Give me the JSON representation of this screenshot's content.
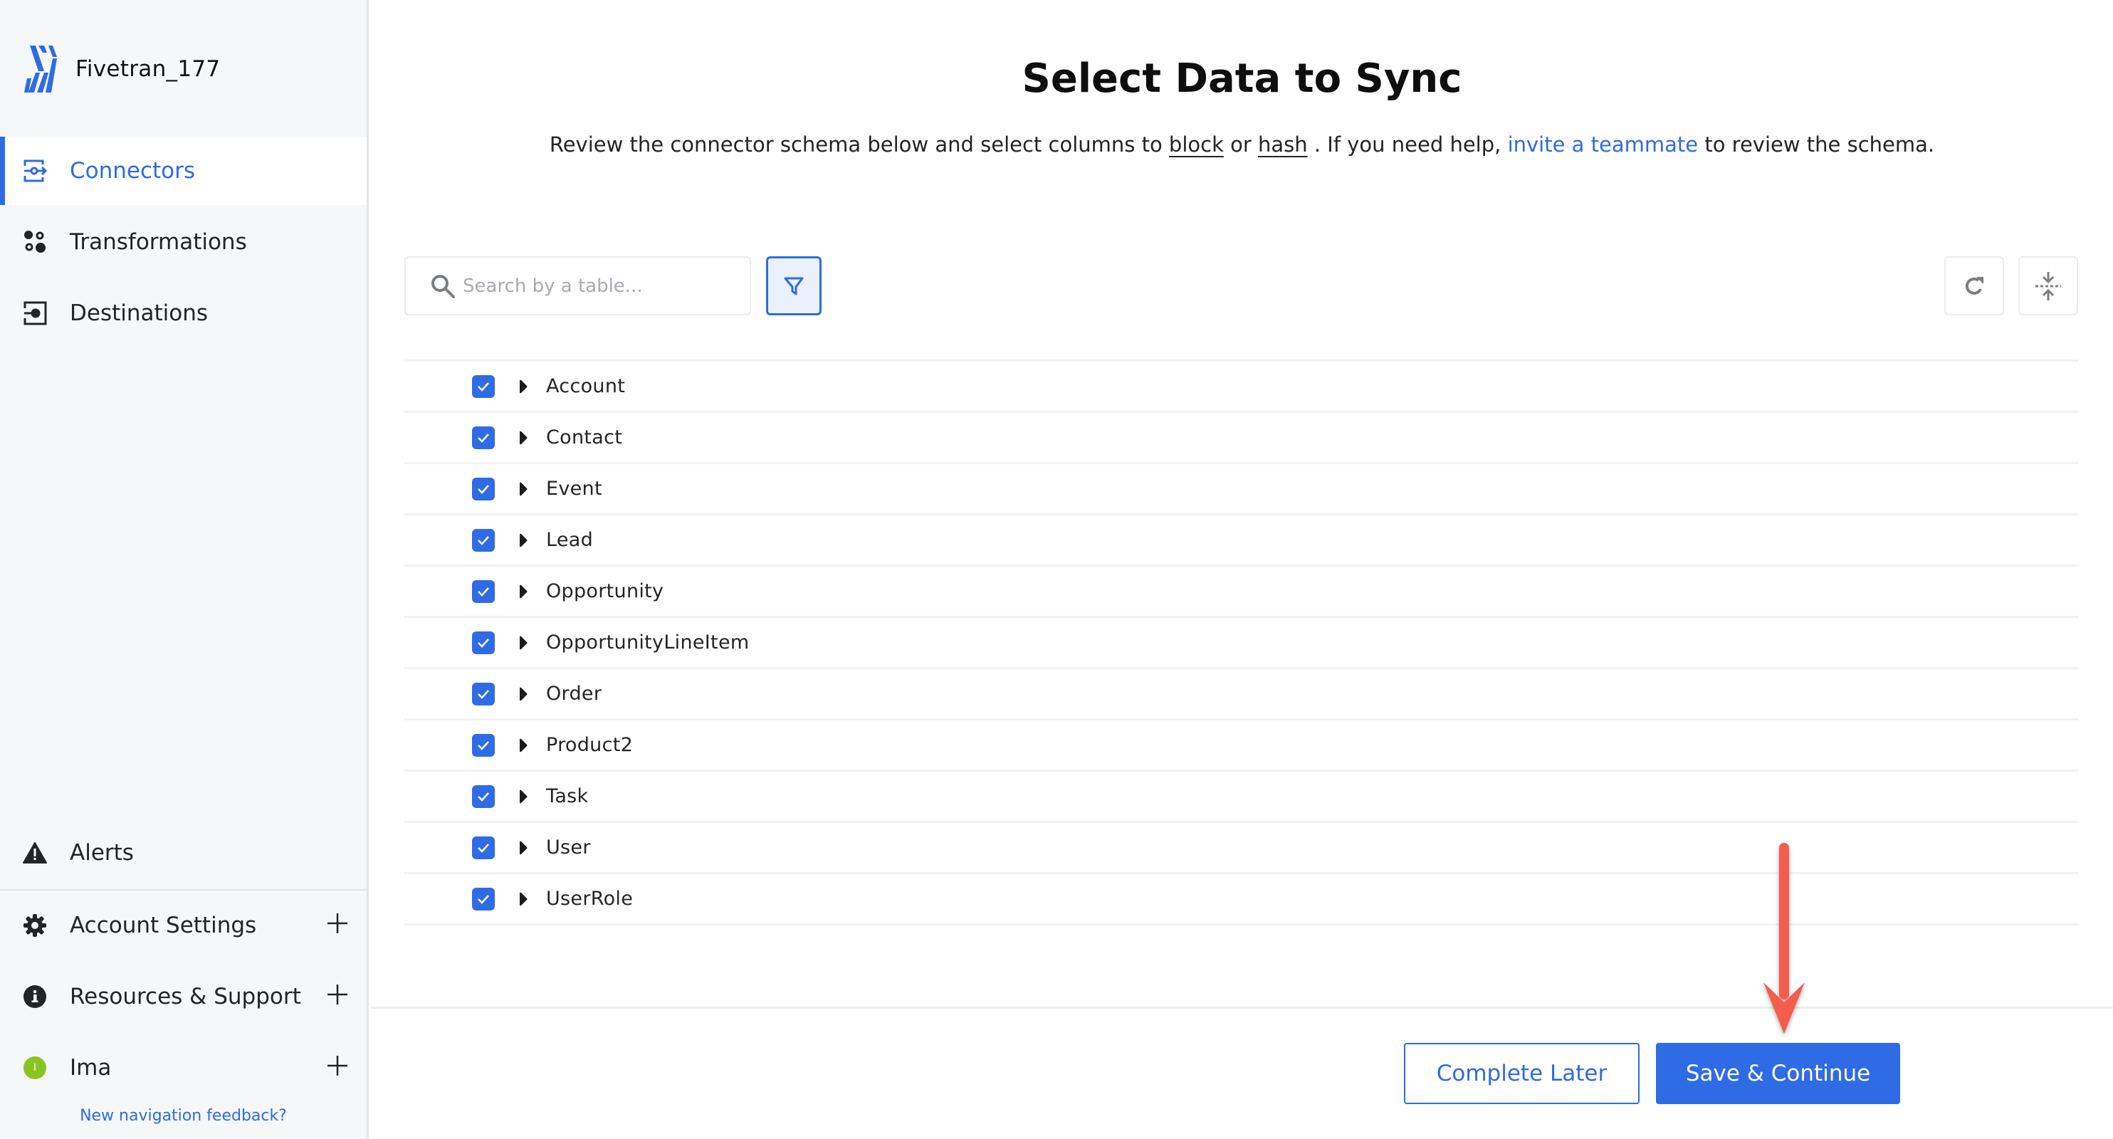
{
  "brand": {
    "name": "Fivetran_177"
  },
  "sidebar": {
    "nav": [
      {
        "label": "Connectors",
        "icon": "connectors-icon",
        "active": true
      },
      {
        "label": "Transformations",
        "icon": "transformations-icon",
        "active": false
      },
      {
        "label": "Destinations",
        "icon": "destinations-icon",
        "active": false
      }
    ],
    "bottom": [
      {
        "label": "Alerts",
        "icon": "alert-triangle-icon"
      },
      {
        "label": "Account Settings",
        "icon": "gear-icon",
        "expandable": true
      },
      {
        "label": "Resources & Support",
        "icon": "info-icon",
        "expandable": true
      },
      {
        "label": "Ima",
        "icon": "avatar",
        "avatar_initial": "I",
        "expandable": true
      }
    ],
    "feedback_link": "New navigation feedback?"
  },
  "main": {
    "title": "Select Data to Sync",
    "subtitle": {
      "part1": "Review the connector schema below and select columns to",
      "block": "block",
      "or": "or",
      "hash": "hash",
      "part2": ". If you need help,",
      "invite_link": "invite a teammate",
      "part3": "to review the schema."
    },
    "search": {
      "placeholder": "Search by a table...",
      "value": ""
    },
    "tables": [
      {
        "name": "Account",
        "checked": true
      },
      {
        "name": "Contact",
        "checked": true
      },
      {
        "name": "Event",
        "checked": true
      },
      {
        "name": "Lead",
        "checked": true
      },
      {
        "name": "Opportunity",
        "checked": true
      },
      {
        "name": "OpportunityLineItem",
        "checked": true
      },
      {
        "name": "Order",
        "checked": true
      },
      {
        "name": "Product2",
        "checked": true
      },
      {
        "name": "Task",
        "checked": true
      },
      {
        "name": "User",
        "checked": true
      },
      {
        "name": "UserRole",
        "checked": true
      }
    ],
    "buttons": {
      "complete_later": "Complete Later",
      "save_continue": "Save & Continue"
    }
  },
  "colors": {
    "accent": "#2f6be4",
    "sidebar_bg": "#f6f7f9",
    "avatar": "#88c424",
    "annotation_arrow": "#f45b4e"
  }
}
